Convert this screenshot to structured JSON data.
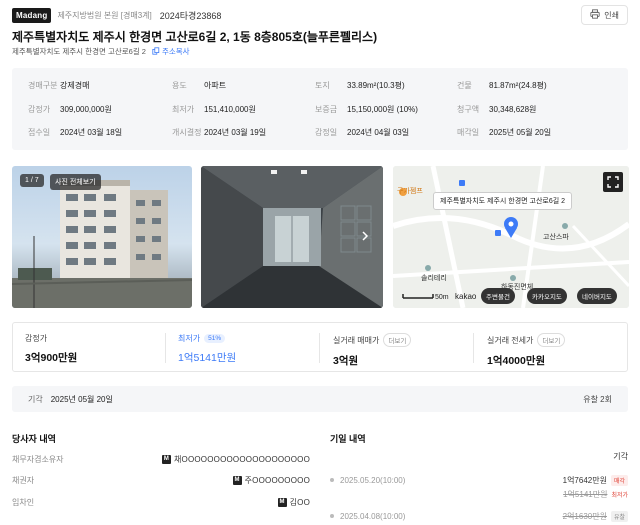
{
  "header": {
    "logo": "Madang",
    "court": "제주지방법원 본원 [경매3계]",
    "case_no": "2024타경23868",
    "print_label": "인쇄"
  },
  "title": "제주특별자치도 제주시 한경면 고산로6길 2, 1동 8층805호(늘푸른펠리스)",
  "sub_address": "제주특별자치도 제주시 한경면 고산로6길 2",
  "copy_label": "주소복사",
  "info": {
    "usage_k": "경매구분",
    "usage_v": "강제경매",
    "type_k": "용도",
    "type_v": "아파트",
    "land_k": "토지",
    "land_v": "33.89m²(10.3평)",
    "bldg_k": "건물",
    "bldg_v": "81.87m²(24.8평)",
    "appraisal_k": "감정가",
    "appraisal_v": "309,000,000원",
    "min_k": "최저가",
    "min_v": "151,410,000원",
    "deposit_k": "보증금",
    "deposit_v": "15,150,000원 (10%)",
    "claim_k": "청구액",
    "claim_v": "30,348,628원",
    "receipt_k": "접수일",
    "receipt_v": "2024년 03월 18일",
    "start_k": "개시결정",
    "start_v": "2024년 03월 19일",
    "apprdate_k": "감정일",
    "apprdate_v": "2024년 04월 03일",
    "sale_k": "매각일",
    "sale_v": "2025년 05월 20일"
  },
  "photos": {
    "counter": "1 / 7",
    "view_all": "사진 전체보기"
  },
  "map": {
    "address_bubble": "제주특별자치도 제주시 한경면 고산로6길 2",
    "poi_1": "구가젬프",
    "poi_2": "고산스파",
    "poi_3": "솔리테리",
    "poi_4": "하동진면체",
    "scale": "50m",
    "brand": "kakao",
    "btn_nearby": "주변물건",
    "btn_kakao": "카카오지도",
    "btn_naver": "네이버지도"
  },
  "prices": {
    "appraisal_label": "감정가",
    "appraisal": "3억900만원",
    "min_label": "최저가",
    "min_badge": "51%",
    "min": "1억5141만원",
    "trade_label": "실거래 매매가",
    "trade_more": "더보기",
    "trade": "3억원",
    "lease_label": "실거래 전세가",
    "lease_more": "더보기",
    "lease": "1억4000만원"
  },
  "schedule": {
    "date_label": "기각",
    "date": "2025년 05월 20일",
    "fail": "유찰 2회"
  },
  "parties": {
    "title": "당사자 내역",
    "rows": [
      {
        "k": "채무자겸소유자",
        "v": "채OOOOOOOOOOOOOOOOOOOO"
      },
      {
        "k": "채권자",
        "v": "주OOOOOOOOO"
      },
      {
        "k": "임차인",
        "v": "김OO"
      }
    ]
  },
  "history": {
    "title": "기일 내역",
    "header": "기각",
    "rows": [
      {
        "date": "2025.05.20(10:00)",
        "amount": "1억7642만원",
        "tag": "매각",
        "amount2": "1억5141만원",
        "tag2": "최저가"
      },
      {
        "date": "2025.04.08(10:00)",
        "amount": "2억1630만원",
        "tag": "유찰"
      }
    ]
  },
  "colors": {
    "accent": "#3d7bf7",
    "sold": "#e0473b"
  }
}
